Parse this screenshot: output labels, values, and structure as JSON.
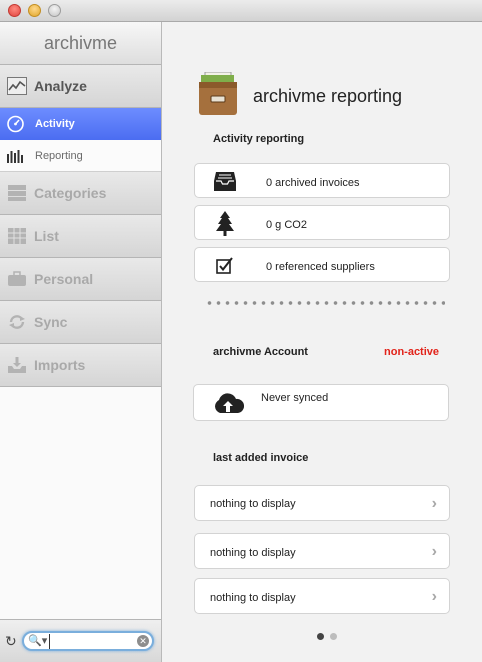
{
  "app": {
    "name": "archivme"
  },
  "sidebar": {
    "sections": [
      {
        "label": "Analyze",
        "icon": "chart-line-icon"
      },
      {
        "label": "Categories",
        "icon": "drawers-icon"
      },
      {
        "label": "List",
        "icon": "calendar-grid-icon"
      },
      {
        "label": "Personal",
        "icon": "briefcase-icon"
      },
      {
        "label": "Sync",
        "icon": "sync-arrows-icon"
      },
      {
        "label": "Imports",
        "icon": "tray-import-icon"
      }
    ],
    "analyze_items": [
      {
        "label": "Activity",
        "icon": "gauge-icon",
        "active": true
      },
      {
        "label": "Reporting",
        "icon": "bar-chart-icon",
        "active": false
      }
    ],
    "search": {
      "value": "",
      "placeholder": ""
    }
  },
  "main": {
    "title": "archivme reporting",
    "activity": {
      "heading": "Activity reporting",
      "stats": [
        {
          "label": "0 archived invoices",
          "icon": "inbox-tray-icon"
        },
        {
          "label": "0 g CO2",
          "icon": "tree-icon"
        },
        {
          "label": "0 referenced suppliers",
          "icon": "checkbox-icon"
        }
      ]
    },
    "account": {
      "heading": "archivme Account",
      "status": "non-active",
      "sync_text": "Never synced"
    },
    "invoices": {
      "heading": "last added invoice",
      "items": [
        "nothing to display",
        "nothing to display",
        "nothing to display"
      ]
    },
    "pager": {
      "pages": 2,
      "current": 1
    }
  },
  "colors": {
    "active_item": "#4f70f3",
    "status_inactive": "#e2231a"
  }
}
